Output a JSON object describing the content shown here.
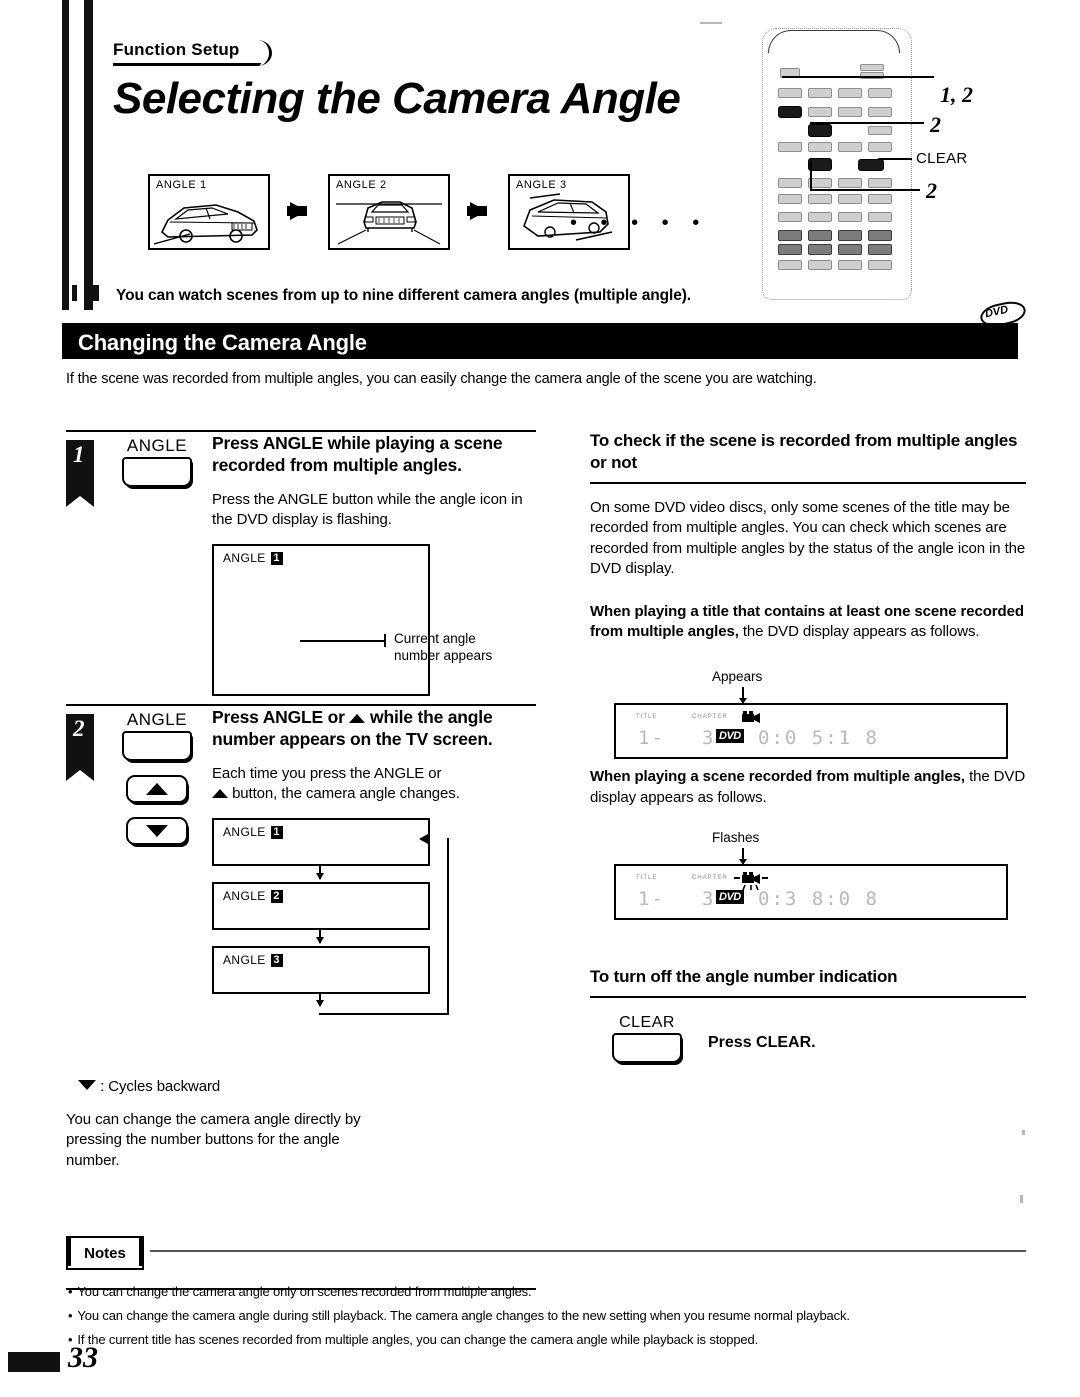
{
  "header": {
    "eyebrow": "Function Setup",
    "title": "Selecting the Camera Angle"
  },
  "remote": {
    "callouts": [
      {
        "label": "1, 2"
      },
      {
        "label": "2"
      },
      {
        "label": "CLEAR"
      },
      {
        "label": "2"
      }
    ]
  },
  "angle_strip": {
    "boxes": [
      {
        "label": "ANGLE  1"
      },
      {
        "label": "ANGLE  2"
      },
      {
        "label": "ANGLE  3"
      }
    ],
    "ellipsis": "• • • • •",
    "caption": "You can watch scenes from up to nine different camera angles (multiple angle)."
  },
  "section": {
    "bar_title": "Changing the Camera Angle",
    "badge": "DVD",
    "intro": "If the scene was recorded from multiple angles, you can easily change the camera angle of the scene you are watching."
  },
  "steps": [
    {
      "number": "1",
      "button_label": "ANGLE",
      "heading": "Press ANGLE while playing a scene recorded from multiple angles.",
      "body": "Press the ANGLE button while the angle icon in the DVD display is flashing.",
      "screen_label": "ANGLE",
      "screen_number": "1",
      "callout": "Current angle number appears"
    },
    {
      "number": "2",
      "button_label": "ANGLE",
      "heading_part1": "Press ANGLE or ",
      "heading_part2": " while the angle number appears on the TV screen.",
      "body_part1": "Each time you press the ANGLE or",
      "body_part2": " button, the camera angle changes.",
      "cycle": [
        {
          "label": "ANGLE",
          "number": "1"
        },
        {
          "label": "ANGLE",
          "number": "2"
        },
        {
          "label": "ANGLE",
          "number": "3"
        }
      ],
      "cycle_note": ": Cycles backward",
      "footer": "You can change the camera angle directly by pressing the number buttons for the angle number."
    }
  ],
  "right_column": {
    "heading1": "To check if the scene is recorded from multiple angles or not",
    "para1": "On some DVD video discs, only some scenes of the title may be recorded from multiple angles. You can check which scenes are recorded from multiple angles by the status of the angle icon in the DVD display.",
    "para2_bold": "When playing a title that contains at least one scene recorded from multiple angles,",
    "para2_rest": " the DVD display appears as follows.",
    "display1": {
      "pointer_label": "Appears",
      "mini_left": "TITLE",
      "mini_mid": "CHAPTER",
      "seg_left": "1-",
      "seg_chapter": "3",
      "tag": "DVD",
      "seg_time": "0:0 5:1 8"
    },
    "para3_bold": "When playing a scene recorded from multiple angles,",
    "para3_rest": " the DVD display appears as follows.",
    "display2": {
      "pointer_label": "Flashes",
      "mini_left": "TITLE",
      "mini_mid": "CHAPTER",
      "seg_left": "1-",
      "seg_chapter": "3",
      "tag": "DVD",
      "seg_time": "0:3 8:0 8"
    },
    "heading2": "To turn off the angle number indication",
    "clear_button_label": "CLEAR",
    "clear_instruction": "Press CLEAR."
  },
  "notes": {
    "title": "Notes",
    "items": [
      "You can change the camera angle only on scenes recorded from multiple angles.",
      "You can change the camera angle during still playback. The camera angle changes to the new setting when you resume normal playback.",
      "If the current title has scenes recorded from multiple angles, you can change the camera angle while playback is stopped."
    ]
  },
  "page_number": "33"
}
